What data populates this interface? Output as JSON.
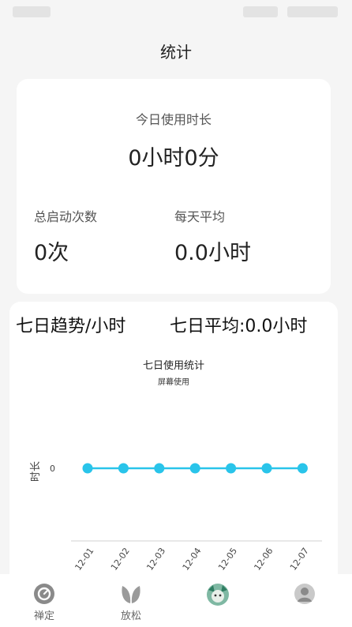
{
  "page": {
    "title": "统计"
  },
  "today": {
    "label": "今日使用时长",
    "value": "0小时0分",
    "total_launches_label": "总启动次数",
    "total_launches_value": "0次",
    "daily_avg_label": "每天平均",
    "daily_avg_value": "0.0小时"
  },
  "trend": {
    "left_title": "七日趋势/小时",
    "right_title": "七日平均:0.0小时"
  },
  "chart_data": {
    "type": "line",
    "title": "七日使用统计",
    "subtitle": "屏幕使用",
    "ylabel": "时长",
    "xlabel": "",
    "categories": [
      "12-01",
      "12-02",
      "12-03",
      "12-04",
      "12-05",
      "12-06",
      "12-07"
    ],
    "series": [
      {
        "values": [
          0,
          0,
          0,
          0,
          0,
          0,
          0
        ],
        "color": "#29c4ea"
      }
    ],
    "yticks": [
      0
    ],
    "grid": false,
    "legend": "none"
  },
  "tabs": [
    {
      "label": "禅定",
      "icon": "timer-icon"
    },
    {
      "label": "放松",
      "icon": "leaf-icon"
    },
    {
      "label": "",
      "icon": "stats-avatar-icon"
    },
    {
      "label": "",
      "icon": "profile-avatar-icon"
    }
  ],
  "colors": {
    "accent": "#29c4ea",
    "background": "#f5f5f5",
    "card": "#ffffff"
  }
}
